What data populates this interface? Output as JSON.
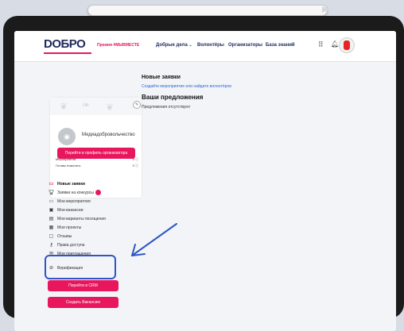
{
  "header": {
    "logo": "DOБРО",
    "promo": "Премия #МЫВМЕСТЕ",
    "nav": [
      {
        "label": "Добрые дела",
        "chevron": "⌄"
      },
      {
        "label": "Волонтёры"
      },
      {
        "label": "Организаторы"
      },
      {
        "label": "База знаний"
      }
    ]
  },
  "profile": {
    "org_name": "Медиадобровольчество",
    "stats": [
      {
        "label": "Мероприятия:",
        "value": "0 ⓘ"
      },
      {
        "label": "Готовы помогать:",
        "value": "0 ⓘ"
      }
    ],
    "profile_button": "Перейти в профиль организатора"
  },
  "main": {
    "heading_new": "Новые заявки",
    "link_text": "Создайте мероприятие или найдите волонтёров",
    "heading_offers": "Ваши предложения",
    "offers_empty": "Предложения отсутствуют"
  },
  "sidebar": {
    "items": [
      {
        "label": "Новые заявки",
        "icon": "calendar-icon"
      },
      {
        "label": "Заявки на конкурсы",
        "icon": "trophy-icon"
      },
      {
        "label": "Мои мероприятия",
        "icon": "calendar-icon"
      },
      {
        "label": "Мои вакансии",
        "icon": "vacancy-icon"
      },
      {
        "label": "Мои варианты посещения",
        "icon": "list-icon"
      },
      {
        "label": "Мои проекты",
        "icon": "project-icon"
      },
      {
        "label": "Отзывы",
        "icon": "chat-icon"
      },
      {
        "label": "Права доступа",
        "icon": "key-icon"
      },
      {
        "label": "Мои приглашения",
        "icon": "invite-icon"
      },
      {
        "label": "Верификация",
        "icon": "verify-icon"
      }
    ],
    "crm_button": "Перейти в CRM",
    "vacancy_button": "Создать Вакансию"
  },
  "colors": {
    "accent": "#e8175d",
    "brand": "#1e2a5a",
    "annotation": "#2f55c9"
  }
}
